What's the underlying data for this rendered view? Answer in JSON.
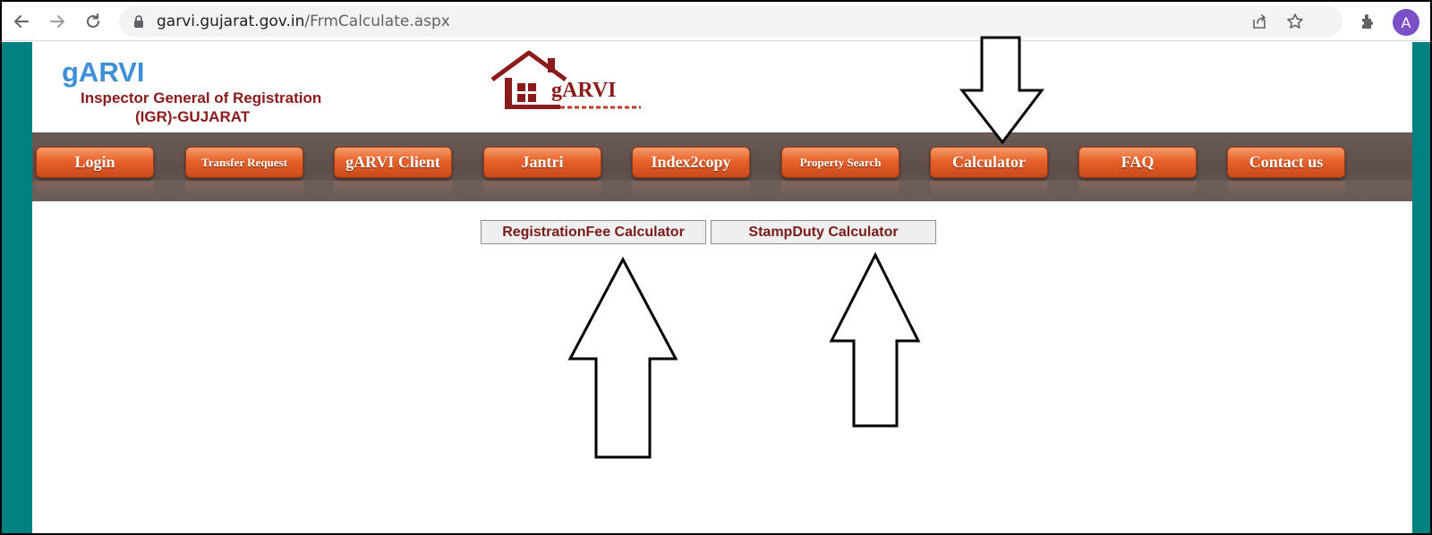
{
  "browser": {
    "url_host": "garvi.gujarat.gov.in",
    "url_path": "/FrmCalculate.aspx",
    "avatar_letter": "A"
  },
  "header": {
    "title": "gARVI",
    "subtitle_line1": "Inspector General of Registration",
    "subtitle_line2": "(IGR)-GUJARAT",
    "logo_text": "gARVI"
  },
  "nav": {
    "items": [
      {
        "label": "Login"
      },
      {
        "label": "Transfer Request"
      },
      {
        "label": "gARVI Client"
      },
      {
        "label": "Jantri"
      },
      {
        "label": "Index2copy"
      },
      {
        "label": "Property Search"
      },
      {
        "label": "Calculator"
      },
      {
        "label": "FAQ"
      },
      {
        "label": "Contact us"
      }
    ]
  },
  "calculators": {
    "registration_fee": "RegistrationFee Calculator",
    "stamp_duty": "StampDuty Calculator"
  },
  "colors": {
    "page_side": "#008080",
    "nav_button": "#e8622a",
    "title_blue": "#3d8fd8",
    "subtitle_red": "#8b1a1a"
  }
}
